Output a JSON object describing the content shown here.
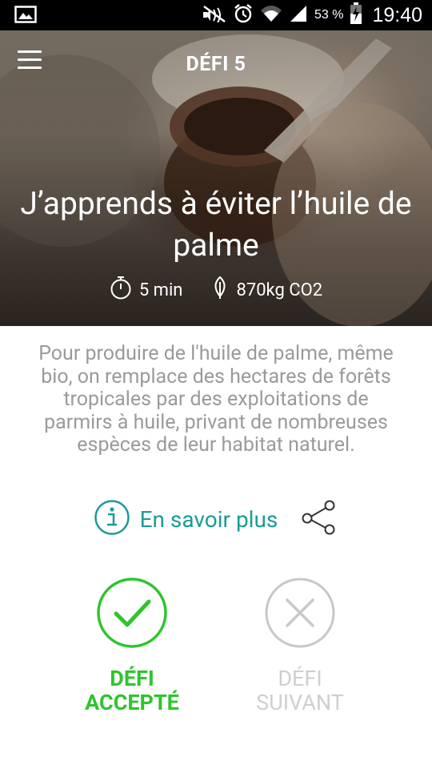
{
  "status_bar": {
    "battery_percent": "53 %",
    "time": "19:40",
    "icons": [
      "image-icon",
      "mute-icon",
      "alarm-icon",
      "wifi-icon",
      "signal-icon",
      "battery-charging-icon"
    ]
  },
  "header": {
    "menu_icon": "hamburger-menu-icon",
    "challenge_label": "DÉFI 5"
  },
  "challenge": {
    "title": "J’apprends à éviter l’huile de palme",
    "duration": "5 min",
    "co2": "870kg CO2",
    "duration_icon": "stopwatch-icon",
    "co2_icon": "leaf-icon",
    "description": "Pour produire de l'huile de palme, même bio, on remplace des hectares de forêts tropicales par des exploitations de parmirs à huile, privant de nombreuses espèces de leur habitat naturel."
  },
  "links": {
    "learn_more": "En savoir plus",
    "info_icon": "info-icon",
    "share_icon": "share-icon"
  },
  "actions": {
    "accept_label": "DÉFI\nACCEPTÉ",
    "next_label": "DÉFI\nSUIVANT"
  },
  "colors": {
    "accent_green": "#2ec52e",
    "link_teal": "#1a9c96",
    "text_grey": "#9a9a9a",
    "disabled_grey": "#c8c8c8"
  }
}
